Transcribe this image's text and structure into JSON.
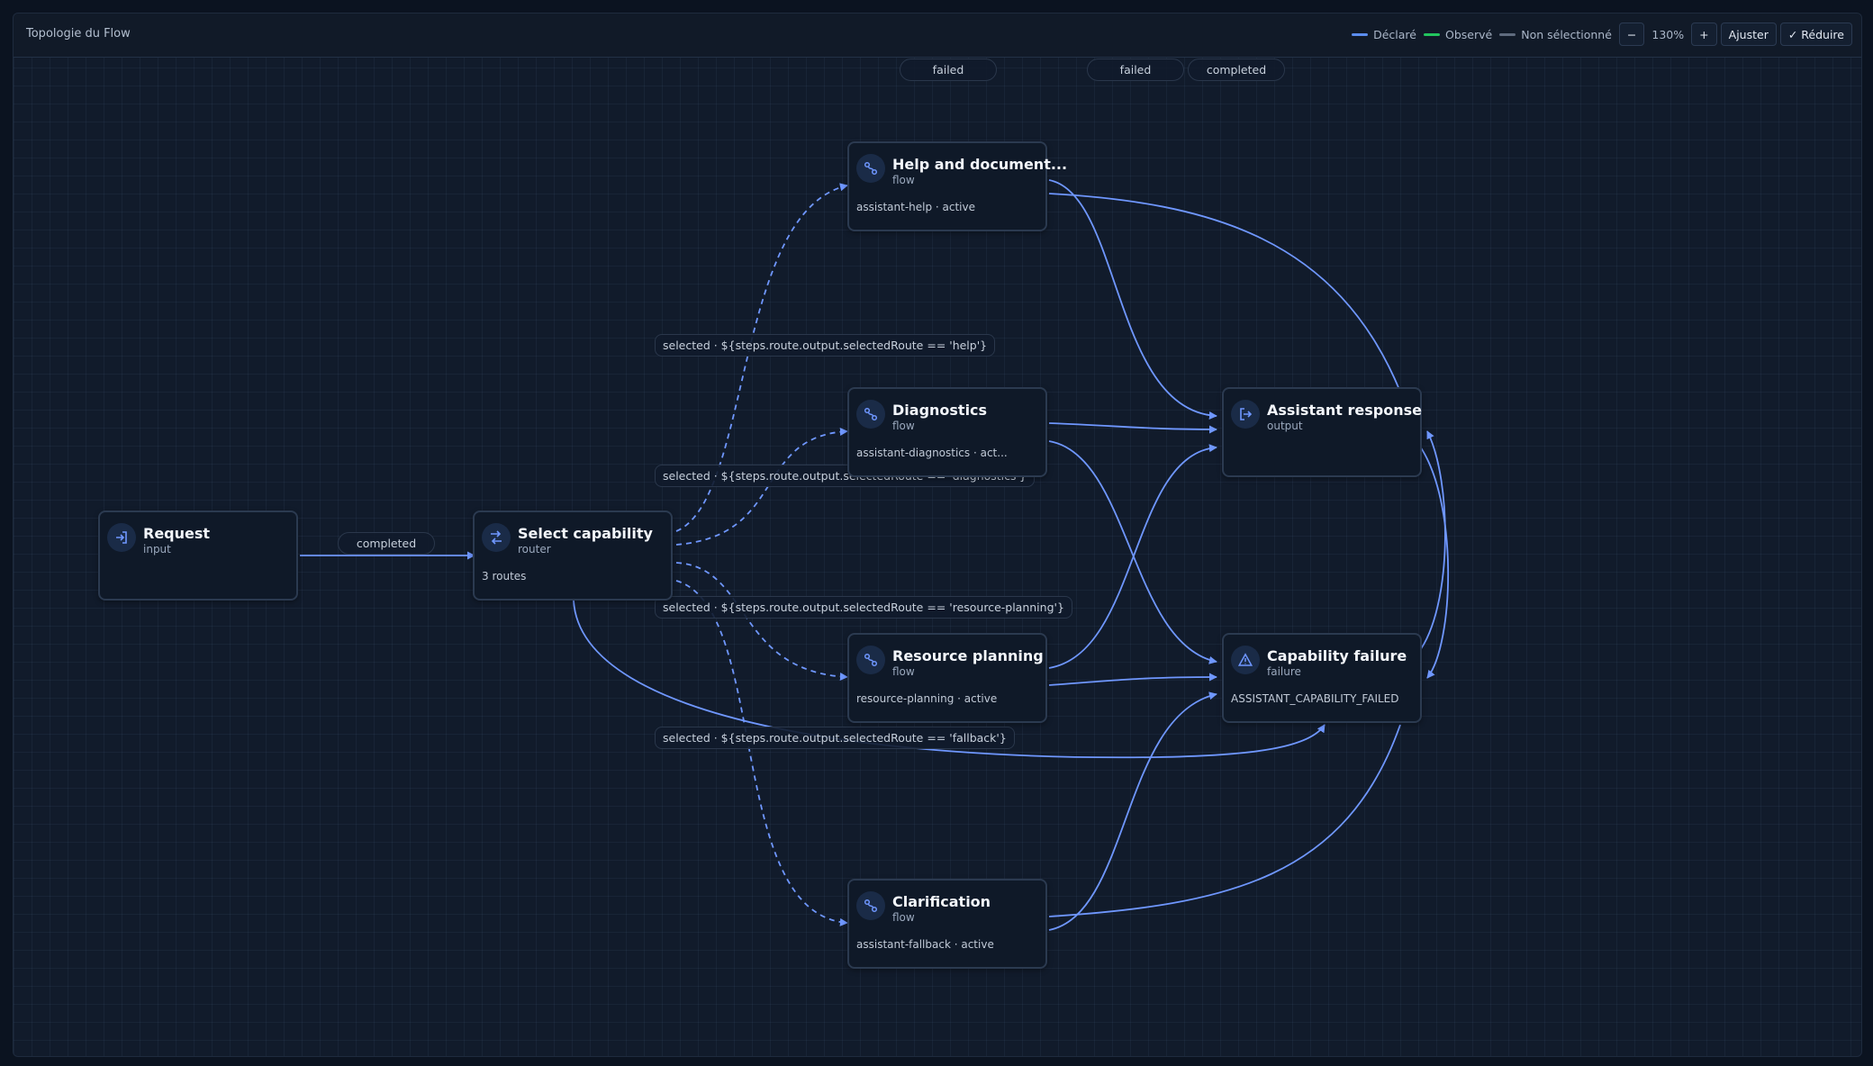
{
  "header": {
    "title": "Topologie du Flow"
  },
  "legend": {
    "items": [
      {
        "label": "Déclaré",
        "color": "#5b8def"
      },
      {
        "label": "Observé",
        "color": "#22c55e"
      },
      {
        "label": "Non sélectionné",
        "color": "#5f6b7e"
      }
    ]
  },
  "controls": {
    "zoom_out": "−",
    "zoom_level": "130%",
    "zoom_in": "+",
    "fit": "Ajuster",
    "reduce": "✓ Réduire"
  },
  "colors": {
    "edge": "#6f97ff",
    "node_border": "#2b3a50",
    "icon": "#6f97ff"
  },
  "nodes": {
    "request": {
      "title": "Request",
      "kind": "input",
      "icon": "enter-icon"
    },
    "select": {
      "title": "Select capability",
      "kind": "router",
      "detail": "3 routes",
      "icon": "router-icon"
    },
    "help": {
      "title": "Help and document...",
      "kind": "flow",
      "detail": "assistant-help · active",
      "icon": "flow-icon"
    },
    "diagnostics": {
      "title": "Diagnostics",
      "kind": "flow",
      "detail": "assistant-diagnostics · act...",
      "icon": "flow-icon"
    },
    "resource": {
      "title": "Resource planning",
      "kind": "flow",
      "detail": "resource-planning · active",
      "icon": "flow-icon"
    },
    "clarification": {
      "title": "Clarification",
      "kind": "flow",
      "detail": "assistant-fallback · active",
      "icon": "flow-icon"
    },
    "response": {
      "title": "Assistant response",
      "kind": "output",
      "icon": "exit-icon"
    },
    "failure": {
      "title": "Capability failure",
      "kind": "failure",
      "detail": "ASSISTANT_CAPABILITY_FAILED",
      "icon": "warning-icon"
    }
  },
  "edge_labels": {
    "completed_request": "completed",
    "route_help": "selected · ${steps.route.output.selectedRoute == 'help'}",
    "route_diagnostics": "selected · ${steps.route.output.selectedRoute == 'diagnostics'}",
    "route_resource": "selected · ${steps.route.output.selectedRoute == 'resource-planning'}",
    "route_fallback": "selected · ${steps.route.output.selectedRoute == 'fallback'}",
    "top_failed_1": "failed",
    "top_failed_2": "failed",
    "top_completed": "completed"
  }
}
